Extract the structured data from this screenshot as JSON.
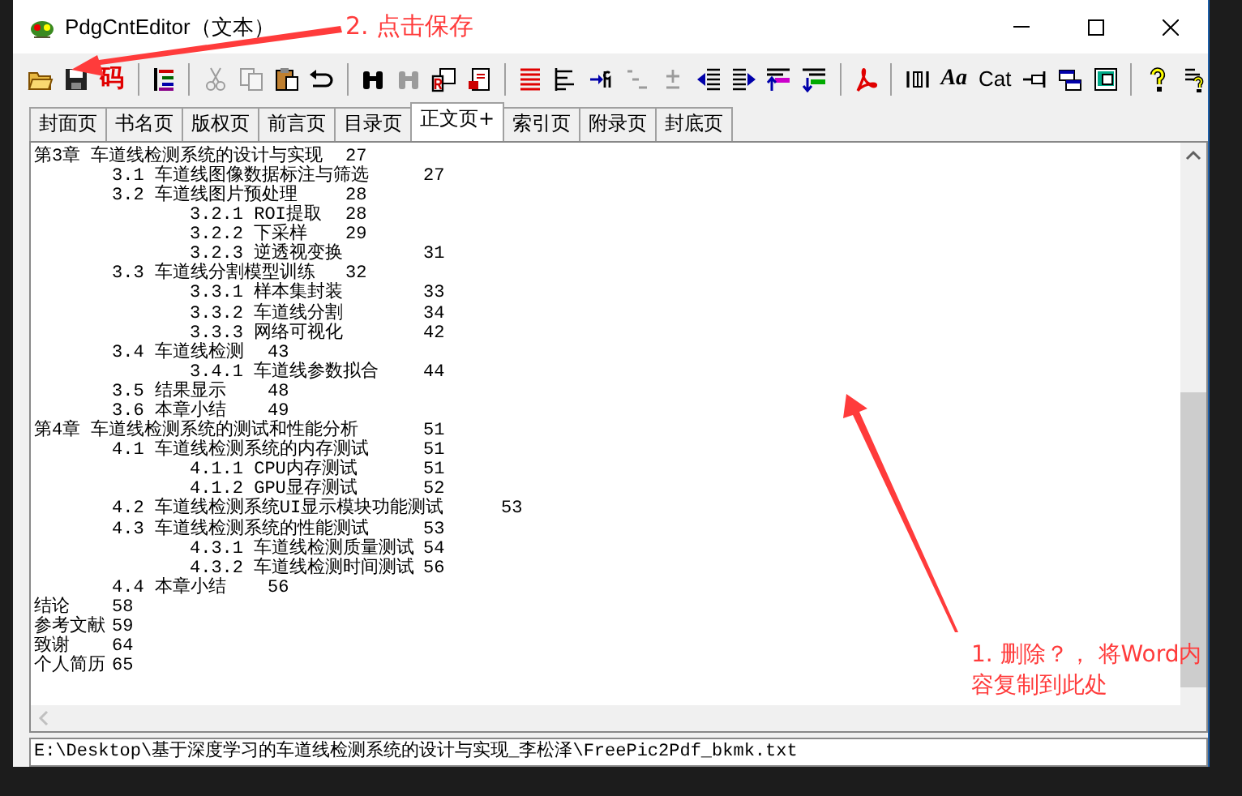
{
  "window": {
    "title": "PdgCntEditor（文本）"
  },
  "toolbar": [
    {
      "kind": "open",
      "disabled": false
    },
    {
      "kind": "save",
      "disabled": false
    },
    {
      "kind": "code",
      "label": "码",
      "disabled": false
    },
    {
      "kind": "sep"
    },
    {
      "kind": "outline",
      "disabled": false
    },
    {
      "kind": "sep"
    },
    {
      "kind": "cut",
      "disabled": true
    },
    {
      "kind": "copy",
      "disabled": true
    },
    {
      "kind": "paste",
      "disabled": false
    },
    {
      "kind": "undo",
      "disabled": false
    },
    {
      "kind": "sep"
    },
    {
      "kind": "find",
      "disabled": false
    },
    {
      "kind": "find",
      "disabled": true
    },
    {
      "kind": "replace",
      "disabled": false
    },
    {
      "kind": "page",
      "disabled": false
    },
    {
      "kind": "sep"
    },
    {
      "kind": "lines",
      "disabled": false
    },
    {
      "kind": "align",
      "disabled": false
    },
    {
      "kind": "number",
      "disabled": false
    },
    {
      "kind": "multilevel",
      "disabled": true
    },
    {
      "kind": "plusminus",
      "disabled": true
    },
    {
      "kind": "indent",
      "disabled": false
    },
    {
      "kind": "outdent",
      "disabled": false
    },
    {
      "kind": "moveup",
      "disabled": false
    },
    {
      "kind": "movedown",
      "disabled": false
    },
    {
      "kind": "sep"
    },
    {
      "kind": "pdf",
      "disabled": false
    },
    {
      "kind": "sep"
    },
    {
      "kind": "columns",
      "disabled": false
    },
    {
      "kind": "font",
      "label": "Aa",
      "disabled": false
    },
    {
      "kind": "category",
      "label": "Cat",
      "disabled": false
    },
    {
      "kind": "pin",
      "disabled": false
    },
    {
      "kind": "windows",
      "disabled": false
    },
    {
      "kind": "monitor",
      "disabled": false
    },
    {
      "kind": "sep"
    },
    {
      "kind": "help",
      "disabled": false
    },
    {
      "kind": "info",
      "disabled": false
    }
  ],
  "tabs": [
    {
      "label": "封面页",
      "selected": false
    },
    {
      "label": "书名页",
      "selected": false
    },
    {
      "label": "版权页",
      "selected": false
    },
    {
      "label": "前言页",
      "selected": false
    },
    {
      "label": "目录页",
      "selected": false
    },
    {
      "label": "正文页+",
      "selected": true
    },
    {
      "label": "索引页",
      "selected": false
    },
    {
      "label": "附录页",
      "selected": false
    },
    {
      "label": "封底页",
      "selected": false
    }
  ],
  "outline": [
    {
      "title": "第3章 车道线检测系统的设计与实现",
      "page": "27",
      "children": [
        {
          "title": "3.1 车道线图像数据标注与筛选",
          "page": "27"
        },
        {
          "title": "3.2 车道线图片预处理",
          "page": "28",
          "children": [
            {
              "title": "3.2.1 ROI提取",
              "page": "28"
            },
            {
              "title": "3.2.2 下采样",
              "page": "29"
            },
            {
              "title": "3.2.3 逆透视变换",
              "page": "31"
            }
          ]
        },
        {
          "title": "3.3 车道线分割模型训练",
          "page": "32",
          "children": [
            {
              "title": "3.3.1 样本集封装",
              "page": "33"
            },
            {
              "title": "3.3.2 车道线分割",
              "page": "34"
            },
            {
              "title": "3.3.3 网络可视化",
              "page": "42"
            }
          ]
        },
        {
          "title": "3.4 车道线检测",
          "page": "43",
          "children": [
            {
              "title": "3.4.1 车道线参数拟合",
              "page": "44"
            }
          ]
        },
        {
          "title": "3.5 结果显示",
          "page": "48"
        },
        {
          "title": "3.6 本章小结",
          "page": "49"
        }
      ]
    },
    {
      "title": "第4章 车道线检测系统的测试和性能分析",
      "page": "51",
      "children": [
        {
          "title": "4.1 车道线检测系统的内存测试",
          "page": "51",
          "children": [
            {
              "title": "4.1.1 CPU内存测试",
              "page": "51"
            },
            {
              "title": "4.1.2 GPU显存测试",
              "page": "52"
            }
          ]
        },
        {
          "title": "4.2 车道线检测系统UI显示模块功能测试",
          "page": "53"
        },
        {
          "title": "4.3 车道线检测系统的性能测试",
          "page": "53",
          "children": [
            {
              "title": "4.3.1 车道线检测质量测试",
              "page": "54"
            },
            {
              "title": "4.3.2 车道线检测时间测试",
              "page": "56"
            }
          ]
        },
        {
          "title": "4.4 本章小结",
          "page": "56"
        }
      ]
    },
    {
      "title": "结论",
      "page": "58"
    },
    {
      "title": "参考文献",
      "page": "59"
    },
    {
      "title": "致谢",
      "page": "64"
    },
    {
      "title": "个人简历",
      "page": "65"
    }
  ],
  "status_bar": {
    "path": "E:\\Desktop\\基于深度学习的车道线检测系统的设计与实现_李松泽\\FreePic2Pdf_bkmk.txt"
  },
  "annotations": [
    {
      "kind": "save-hint",
      "text": "2. 点击保存"
    },
    {
      "kind": "paste-hint",
      "text": "1. 删除？， 将Word内容复制到此处"
    }
  ]
}
